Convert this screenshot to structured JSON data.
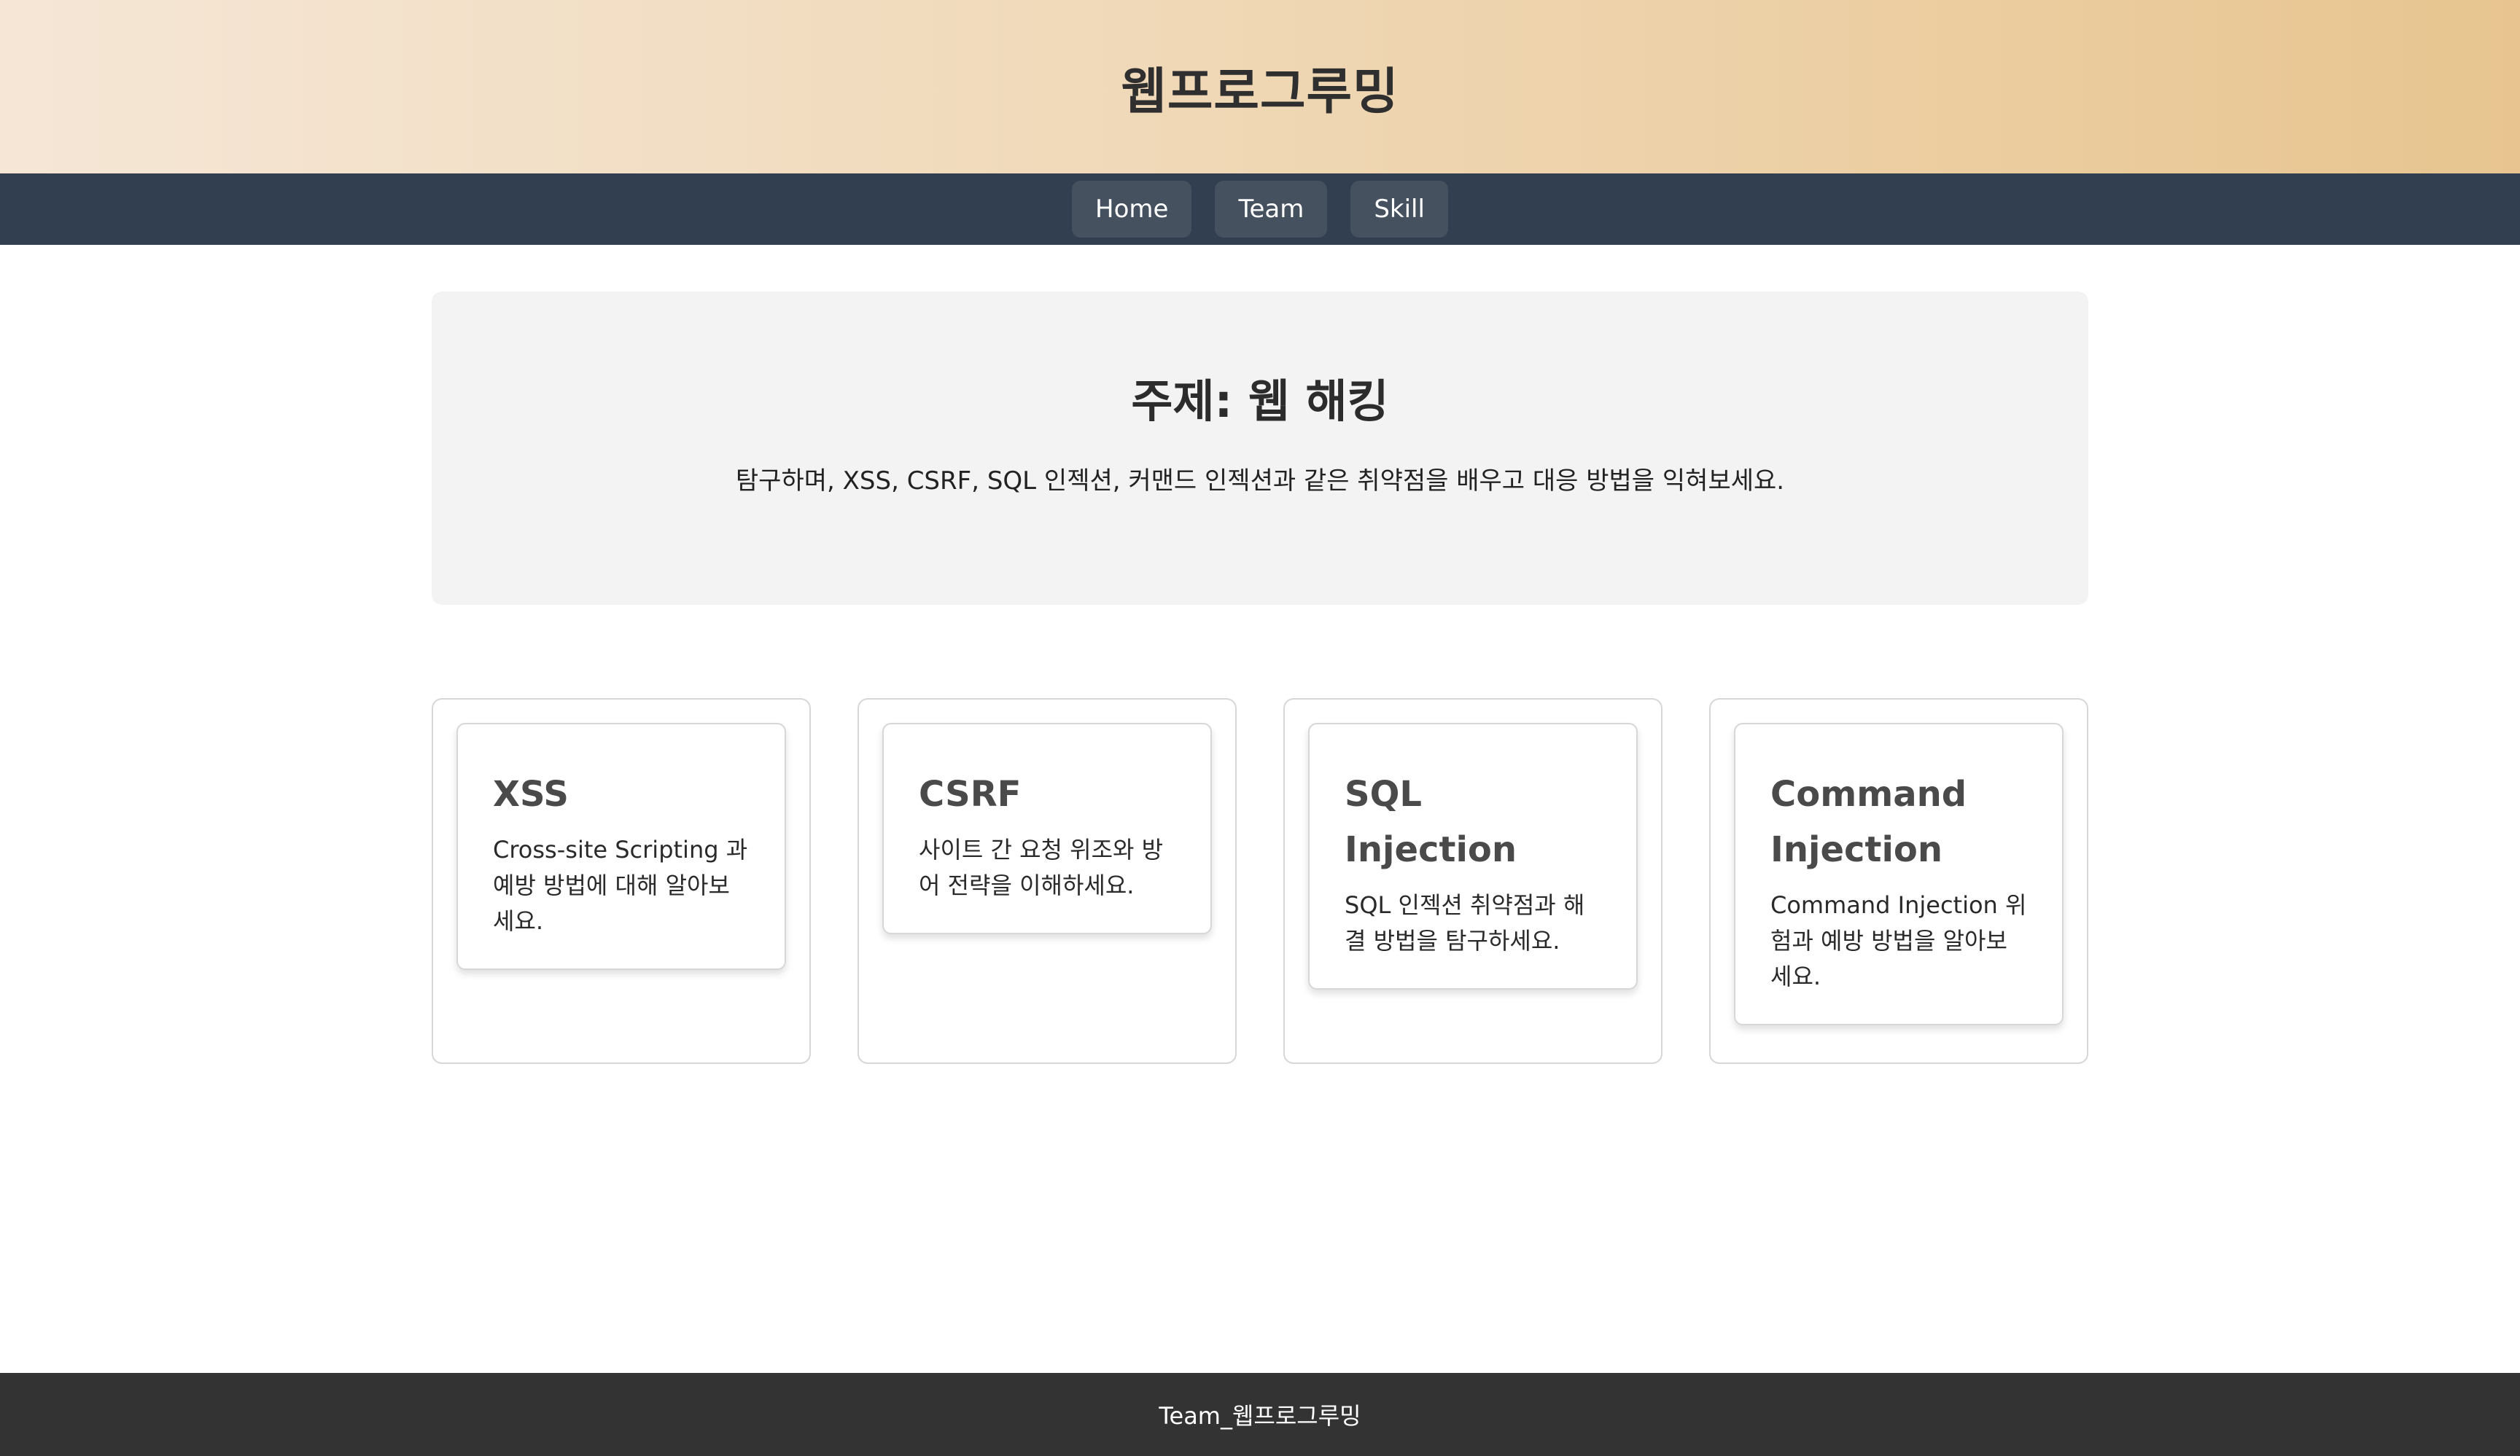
{
  "header": {
    "title": "웹프로그루밍"
  },
  "nav": {
    "items": [
      {
        "label": "Home"
      },
      {
        "label": "Team"
      },
      {
        "label": "Skill"
      }
    ]
  },
  "intro": {
    "title": "주제: 웹 해킹",
    "description": "탐구하며, XSS, CSRF, SQL 인젝션, 커맨드 인젝션과 같은 취약점을 배우고 대응 방법을 익혀보세요."
  },
  "cards": [
    {
      "title": "XSS",
      "description": "Cross-site Scripting 과 예방 방법에 대해 알아보세요."
    },
    {
      "title": "CSRF",
      "description": "사이트 간 요청 위조와 방어 전략을 이해하세요."
    },
    {
      "title": "SQL Injection",
      "description": "SQL 인젝션 취약점과 해결 방법을 탐구하세요."
    },
    {
      "title": "Command Injection",
      "description": "Command Injection 위험과 예방 방법을 알아보세요."
    }
  ],
  "footer": {
    "text": "Team_웹프로그루밍"
  },
  "colors": {
    "nav_background": "#323f50",
    "nav_button": "#46515f",
    "footer_background": "#333333",
    "intro_background": "#f3f3f3",
    "header_gradient_start": "#f5e6d6",
    "header_gradient_end": "#e8c590"
  }
}
